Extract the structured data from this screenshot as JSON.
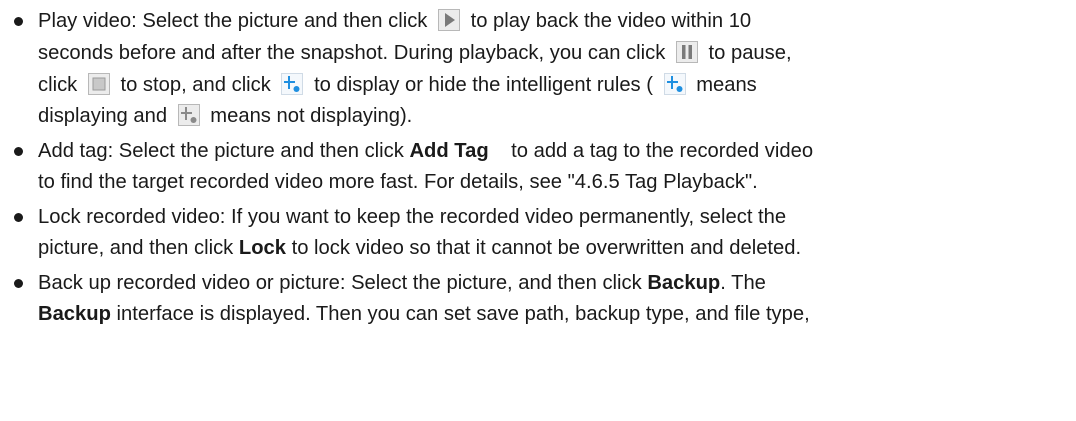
{
  "bullets": [
    {
      "lines": [
        {
          "before": "Play video: Select the picture and then click",
          "after": "to play back the video within 10"
        },
        {
          "text": "seconds before and after the snapshot. During playback, you can click",
          "after": "to pause,"
        },
        {
          "before": "click",
          "mid1": "to stop, and click",
          "mid2": "to display or hide the intelligent rules (",
          "after": "means"
        },
        {
          "before": "displaying and",
          "after": "means not displaying)."
        }
      ],
      "icons": {
        "play": "play-icon",
        "pause": "pause-icon",
        "stop": "stop-icon",
        "rules_on": "intelligent-rules-on-icon",
        "rules_off": "intelligent-rules-off-icon"
      }
    },
    {
      "lines": [
        {
          "before": "Add tag: Select the picture and then click",
          "bold": "Add Tag",
          "after": "to add a tag to the recorded video"
        },
        {
          "text": "to find the target recorded video more fast. For details, see \"4.6.5 Tag Playback\"."
        }
      ]
    },
    {
      "lines": [
        {
          "text": "Lock recorded video: If you want to keep the recorded video permanently, select the"
        },
        {
          "before": "picture, and then click",
          "bold": "Lock",
          "after": "to lock video so that it cannot be overwritten and deleted."
        }
      ]
    },
    {
      "lines": [
        {
          "before": "Back up recorded video or picture: Select the picture, and then click",
          "bold": "Backup",
          "after": ". The"
        },
        {
          "bold": "Backup",
          "after": "interface is displayed. Then you can set save path, backup type, and file type,"
        }
      ]
    }
  ],
  "colors": {
    "icon_blue": "#1e8fe0",
    "icon_gray": "#8a8a8a",
    "icon_frame": "#b8b8b8",
    "icon_bg": "#ececec"
  }
}
